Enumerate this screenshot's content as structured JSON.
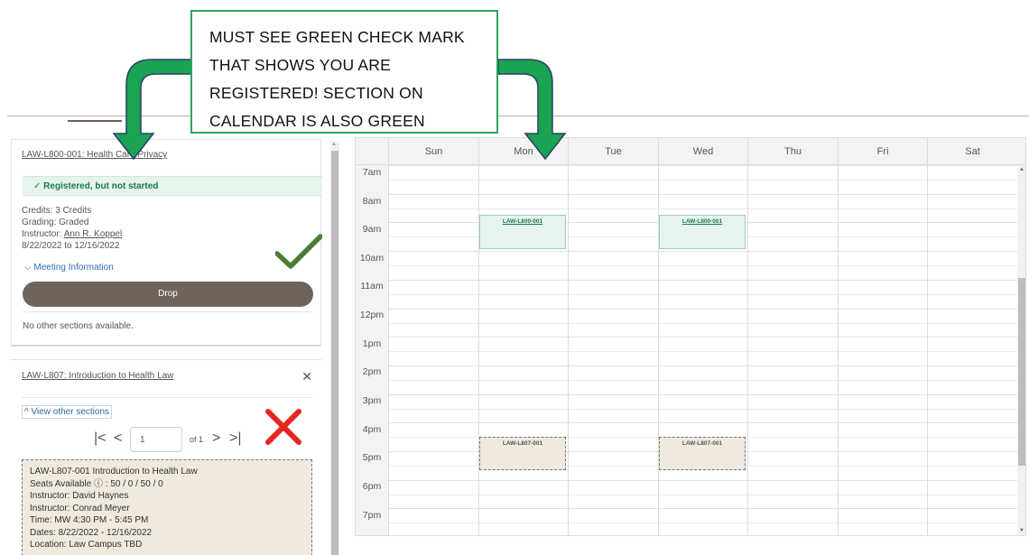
{
  "callout": {
    "lines": [
      "MUST SEE GREEN CHECK MARK",
      "THAT SHOWS YOU ARE",
      "REGISTERED!  SECTION ON",
      "CALENDAR IS ALSO GREEN"
    ]
  },
  "course1": {
    "title_link": "LAW-L800-001: Health Care Privacy",
    "status": "Registered, but not started",
    "credits": "Credits: 3 Credits",
    "grading": "Grading: Graded",
    "instructor_label": "Instructor: ",
    "instructor_name": "Ann R. Koppel",
    "dates": "8/22/2022 to 12/16/2022",
    "meeting_info": "Meeting Information",
    "drop_label": "Drop",
    "no_other": "No other sections available."
  },
  "course2": {
    "title_link": "LAW-L807: Introduction to Health Law",
    "close": "✕",
    "view_other": "View other sections",
    "page_value": "1",
    "page_of": "of 1",
    "details": [
      "LAW-L807-001 Introduction to Health Law",
      "Seats Available ⓘ : 50 / 0 / 50 / 0",
      "Instructor: David Haynes",
      "Instructor: Conrad Meyer",
      "Time: MW 4:30 PM - 5:45 PM",
      "Dates: 8/22/2022 - 12/16/2022",
      "Location: Law Campus TBD"
    ]
  },
  "calendar": {
    "days": [
      "Sun",
      "Mon",
      "Tue",
      "Wed",
      "Thu",
      "Fri",
      "Sat"
    ],
    "times": [
      "7am",
      "8am",
      "9am",
      "10am",
      "11am",
      "12pm",
      "1pm",
      "2pm",
      "3pm",
      "4pm",
      "5pm",
      "6pm",
      "7pm"
    ],
    "events": [
      {
        "label": "LAW-L800-001",
        "day": "Mon",
        "start": "9am",
        "status": "registered"
      },
      {
        "label": "LAW-L800-001",
        "day": "Wed",
        "start": "9am",
        "status": "registered"
      },
      {
        "label": "LAW-L807-001",
        "day": "Mon",
        "start": "4:30pm",
        "status": "planned"
      },
      {
        "label": "LAW-L807-001",
        "day": "Wed",
        "start": "4:30pm",
        "status": "planned"
      }
    ]
  },
  "colors": {
    "registered_green": "#1e7a46",
    "callout_arrow_green": "#1aa350",
    "drop_button": "#6e645b",
    "planned_tan": "#efe9de",
    "x_red": "#e8251f"
  },
  "icons": {
    "status_check": "check-icon",
    "big_check": "large-green-check-icon",
    "big_x": "large-red-x-icon"
  }
}
